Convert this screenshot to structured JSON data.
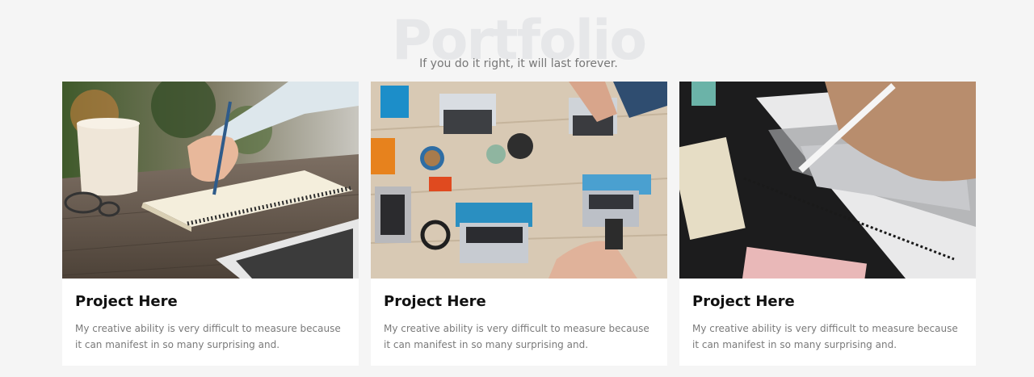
{
  "section": {
    "watermark": "Portfolio",
    "subtitle": "If you do it right, it will last forever."
  },
  "projects": [
    {
      "title": "Project Here",
      "description": "My creative ability is very difficult to measure because it can manifest in so many surprising and.",
      "image": "photo-writing-notebook"
    },
    {
      "title": "Project Here",
      "description": "My creative ability is very difficult to measure because it can manifest in so many surprising and.",
      "image": "photo-team-laptops"
    },
    {
      "title": "Project Here",
      "description": "My creative ability is very difficult to measure because it can manifest in so many surprising and.",
      "image": "photo-answer-sheet"
    }
  ]
}
